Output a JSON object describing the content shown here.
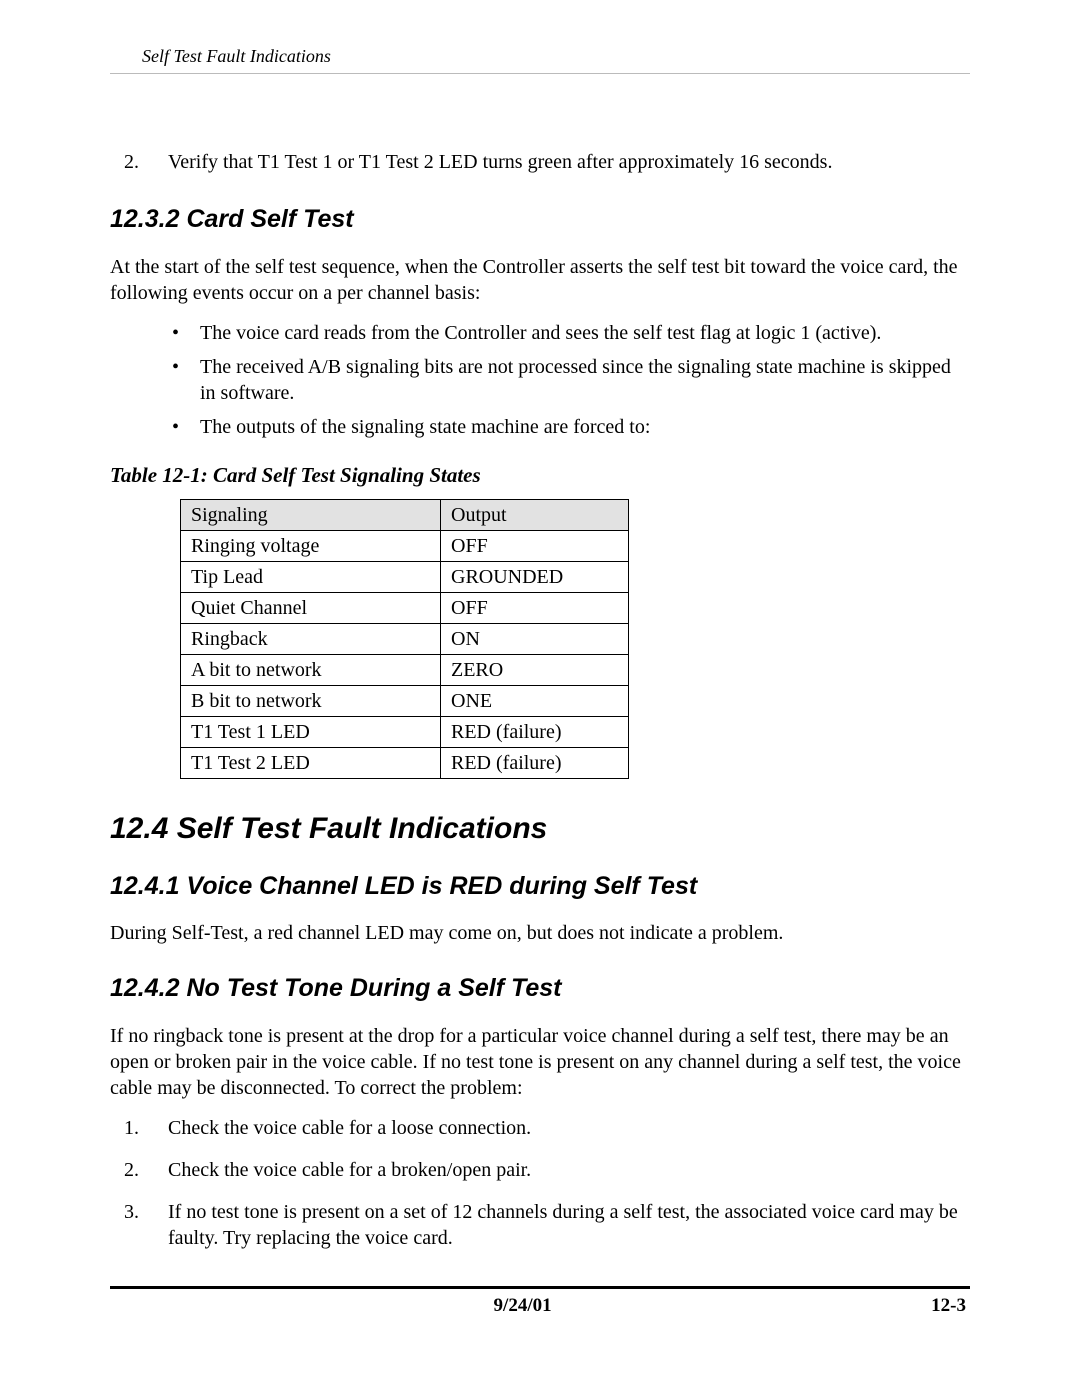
{
  "header": {
    "running_title": "Self Test Fault Indications"
  },
  "intro_list": {
    "item2_num": "2.",
    "item2_text": "Verify that T1 Test 1 or T1 Test 2 LED turns green after approximately 16 seconds."
  },
  "s_12_3_2": {
    "title": "12.3.2 Card Self Test",
    "para": "At the start of the self test sequence, when the Controller asserts the self test bit toward the voice card, the following events occur on a per channel basis:",
    "bullets": [
      "The voice card reads from the Controller and sees the self test flag at logic 1 (active).",
      "The received A/B signaling bits are not processed since the signaling state machine is skipped in software.",
      "The outputs of the signaling state machine are forced to:"
    ]
  },
  "table_12_1": {
    "caption": "Table 12-1: Card Self Test Signaling States",
    "head": {
      "c1": "Signaling",
      "c2": "Output"
    },
    "rows": [
      {
        "c1": "Ringing voltage",
        "c2": "OFF"
      },
      {
        "c1": "Tip Lead",
        "c2": "GROUNDED"
      },
      {
        "c1": "Quiet Channel",
        "c2": "OFF"
      },
      {
        "c1": "Ringback",
        "c2": "ON"
      },
      {
        "c1": "A bit to network",
        "c2": "ZERO"
      },
      {
        "c1": "B bit to network",
        "c2": "ONE"
      },
      {
        "c1": "T1 Test 1 LED",
        "c2": "RED (failure)"
      },
      {
        "c1": "T1 Test 2 LED",
        "c2": "RED (failure)"
      }
    ]
  },
  "s_12_4": {
    "title": "12.4 Self Test Fault Indications"
  },
  "s_12_4_1": {
    "title": "12.4.1 Voice Channel LED is RED during Self Test",
    "para": "During Self-Test, a red channel LED may come on, but does not indicate a problem."
  },
  "s_12_4_2": {
    "title": "12.4.2  No Test Tone During a Self Test",
    "para": "If no ringback tone is present at the drop for a particular voice channel during a self test, there may be an open or broken pair in the voice cable. If no test tone is present on any channel during a self test, the voice cable may be disconnected. To correct the problem:",
    "steps": [
      {
        "num": "1.",
        "text": "Check the voice cable for a loose connection."
      },
      {
        "num": "2.",
        "text": "Check the voice cable for a broken/open pair."
      },
      {
        "num": "3.",
        "text": "If no test tone is present on a set of 12 channels during a self test, the associated voice card may be faulty. Try replacing the voice card."
      }
    ]
  },
  "footer": {
    "date": "9/24/01",
    "page": "12-3"
  }
}
